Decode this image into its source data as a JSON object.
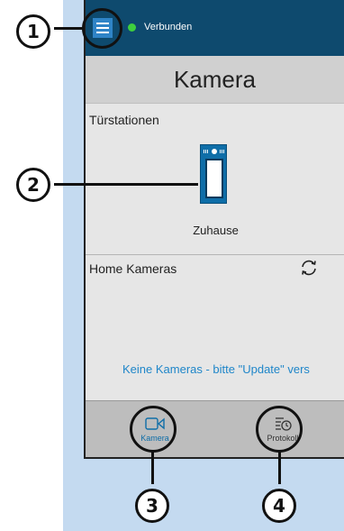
{
  "status": {
    "connection_text": "Verbunden"
  },
  "header": {
    "title": "Kamera"
  },
  "door_stations": {
    "section_label": "Türstationen",
    "items": [
      {
        "label": "Zuhause"
      }
    ]
  },
  "home_cameras": {
    "section_label": "Home Kameras",
    "empty_message": "Keine Kameras - bitte \"Update\" vers"
  },
  "bottom_nav": {
    "items": [
      {
        "label": "Kamera",
        "icon": "video-camera-icon",
        "active": true
      },
      {
        "label": "Protokoll",
        "icon": "history-log-icon",
        "active": false
      }
    ]
  },
  "callouts": [
    "1",
    "2",
    "3",
    "4"
  ],
  "colors": {
    "status_bar": "#0e4a6e",
    "accent": "#1f86c9",
    "connected": "#3ecf3e",
    "background_panel": "#c4daf0"
  }
}
